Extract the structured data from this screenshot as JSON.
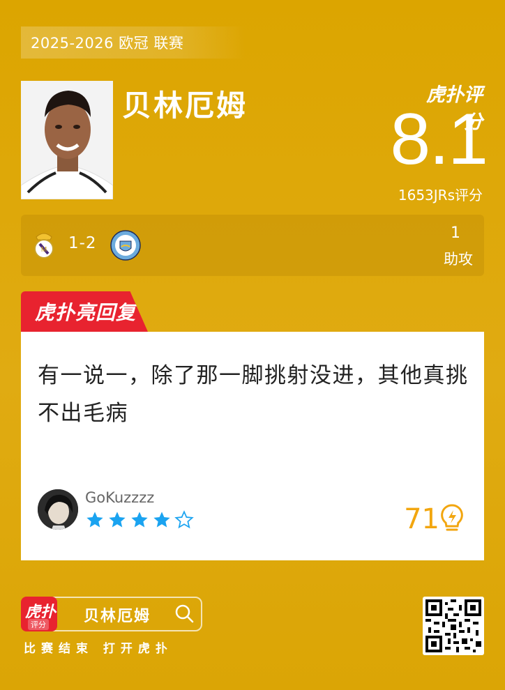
{
  "header": {
    "season_label": "2025-2026 欧冠 联赛",
    "player_name": "贝林厄姆"
  },
  "rating": {
    "brand_label": "虎扑评分",
    "score": "8.1",
    "count_label": "1653JRs评分"
  },
  "match": {
    "home_crest": "real-madrid-crest",
    "score": "1-2",
    "away_crest": "manchester-city-crest",
    "stat_value": "1",
    "stat_label": "助攻"
  },
  "reply": {
    "tag_label": "虎扑亮回复",
    "text": "有一说一，除了那一脚挑射没进，其他真挑不出毛病",
    "username": "GoKuzzzz",
    "stars_filled": 4,
    "stars_total": 5,
    "likes": "71",
    "accent_color": "#F2A60F",
    "star_color": "#1AA3F0"
  },
  "footer": {
    "app_brand": "虎扑",
    "app_sub": "评分",
    "search_text": "贝林厄姆",
    "caption": "比赛结束 打开虎扑"
  },
  "colors": {
    "background": "#DCA500",
    "reply_tag": "#E8232F"
  }
}
